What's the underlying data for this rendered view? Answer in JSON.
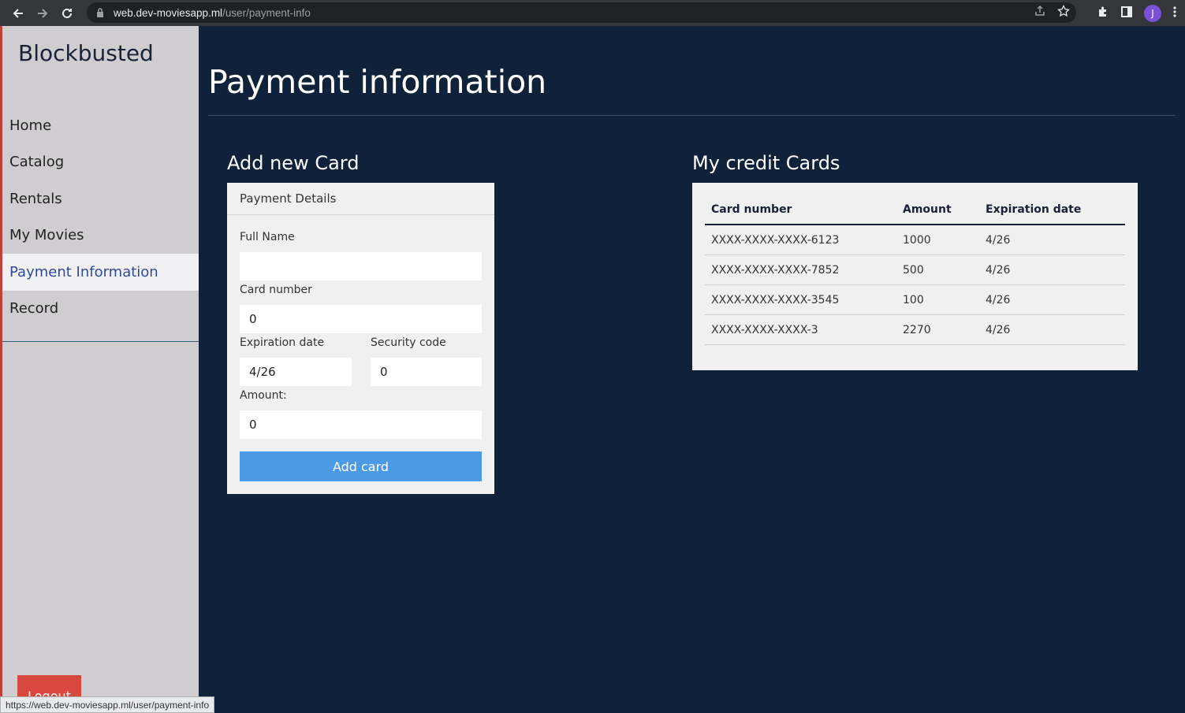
{
  "browser": {
    "url_host": "web.dev-moviesapp.ml",
    "url_path": "/user/payment-info",
    "avatar_letter": "J",
    "status_url": "https://web.dev-moviesapp.ml/user/payment-info"
  },
  "sidebar": {
    "brand": "Blockbusted",
    "items": [
      {
        "label": "Home"
      },
      {
        "label": "Catalog"
      },
      {
        "label": "Rentals"
      },
      {
        "label": "My Movies"
      },
      {
        "label": "Payment Information"
      },
      {
        "label": "Record"
      }
    ],
    "logout_label": "Logout"
  },
  "main": {
    "title": "Payment information",
    "add_card": {
      "section_title": "Add new Card",
      "header": "Payment Details",
      "full_name_label": "Full Name",
      "full_name_value": "",
      "card_number_label": "Card number",
      "card_number_value": "0",
      "expiration_label": "Expiration date",
      "expiration_value": "4/26",
      "security_label": "Security code",
      "security_value": "0",
      "amount_label": "Amount:",
      "amount_value": "0",
      "button_label": "Add card"
    },
    "cards": {
      "section_title": "My credit Cards",
      "columns": [
        "Card number",
        "Amount",
        "Expiration date"
      ],
      "rows": [
        [
          "XXXX-XXXX-XXXX-6123",
          "1000",
          "4/26"
        ],
        [
          "XXXX-XXXX-XXXX-7852",
          "500",
          "4/26"
        ],
        [
          "XXXX-XXXX-XXXX-3545",
          "100",
          "4/26"
        ],
        [
          "XXXX-XXXX-XXXX-3",
          "2270",
          "4/26"
        ]
      ]
    }
  },
  "colors": {
    "background": "#10223a",
    "sidebar": "#d0cdd0",
    "accent_button": "#4a9ae6",
    "logout": "#d9483f",
    "active_menu_text": "#2f4a9a"
  }
}
